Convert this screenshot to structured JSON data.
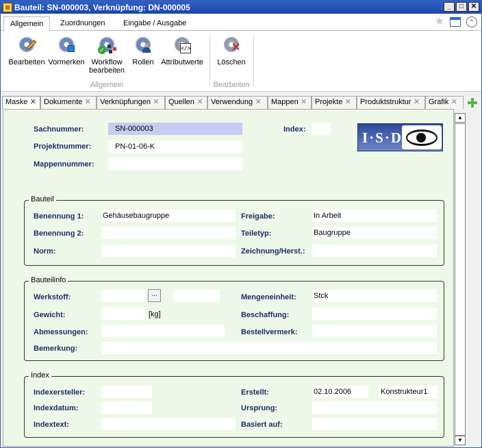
{
  "window": {
    "title": "Bauteil: SN-000003, Verknüpfung: DN-000005"
  },
  "ribbon_tabs": [
    "Allgemein",
    "Zuordnungen",
    "Eingabe / Ausgabe"
  ],
  "ribbon_buttons": {
    "bearbeiten": "Bearbeiten",
    "vormerken": "Vormerken",
    "workflow_1": "Workflow",
    "workflow_2": "bearbeiten",
    "rollen": "Rollen",
    "attributwerte": "Attributwerte",
    "loeschen": "Löschen"
  },
  "ribbon_groups": {
    "allgemein": "Allgemein",
    "bearbeiten": "Bearbeiten"
  },
  "doc_tabs": [
    "Maske",
    "Dokumente",
    "Verknüpfungen",
    "Quellen",
    "Verwendung",
    "Mappen",
    "Projekte",
    "Produktstruktur",
    "Grafik"
  ],
  "header": {
    "sachnummer_label": "Sachnummer:",
    "sachnummer_value": "SN-000003",
    "projektnummer_label": "Projektnummer:",
    "projektnummer_value": "PN-01-06-K",
    "mappennummer_label": "Mappennummer:",
    "mappennummer_value": "",
    "index_label": "Index:",
    "index_value": "",
    "logo_text": "I·S·D"
  },
  "bauteil": {
    "title": "Bauteil",
    "benennung1_label": "Benennung 1:",
    "benennung1_value": "Gehäusebaugruppe",
    "benennung2_label": "Benennung 2:",
    "benennung2_value": "",
    "norm_label": "Norm:",
    "norm_value": "",
    "freigabe_label": "Freigabe:",
    "freigabe_value": "In Arbeit",
    "teiletyp_label": "Teiletyp:",
    "teiletyp_value": "Baugruppe",
    "zeichnung_label": "Zeichnung/Herst.:",
    "zeichnung_value": ""
  },
  "bauteilinfo": {
    "title": "Bauteilinfo",
    "werkstoff_label": "Werkstoff:",
    "werkstoff_value": "",
    "werkstoff_button": "...",
    "werkstoff_extra": "",
    "gewicht_label": "Gewicht:",
    "gewicht_value": "",
    "gewicht_unit": "[kg]",
    "abmessungen_label": "Abmessungen:",
    "abmessungen_value": "",
    "bemerkung_label": "Bemerkung:",
    "bemerkung_value": "",
    "mengeneinheit_label": "Mengeneinheit:",
    "mengeneinheit_value": "Stck",
    "beschaffung_label": "Beschaffung:",
    "beschaffung_value": "",
    "bestellvermerk_label": "Bestellvermerk:",
    "bestellvermerk_value": ""
  },
  "index": {
    "title": "Index",
    "indexersteller_label": "Indexersteller:",
    "indexersteller_value": "",
    "indexdatum_label": "Indexdatum:",
    "indexdatum_value": "",
    "indextext_label": "Indextext:",
    "indextext_value": "",
    "erstellt_label": "Erstellt:",
    "erstellt_date": "02.10.2006",
    "erstellt_user": "Konstrukteur1",
    "ursprung_label": "Ursprung:",
    "ursprung_value": "",
    "basiert_label": "Basiert auf:",
    "basiert_value": ""
  },
  "scrollbar": {
    "up": "▲",
    "down": "▼"
  },
  "icons": {
    "close_tab": "✕",
    "star": "★",
    "collapse": "⌃"
  }
}
